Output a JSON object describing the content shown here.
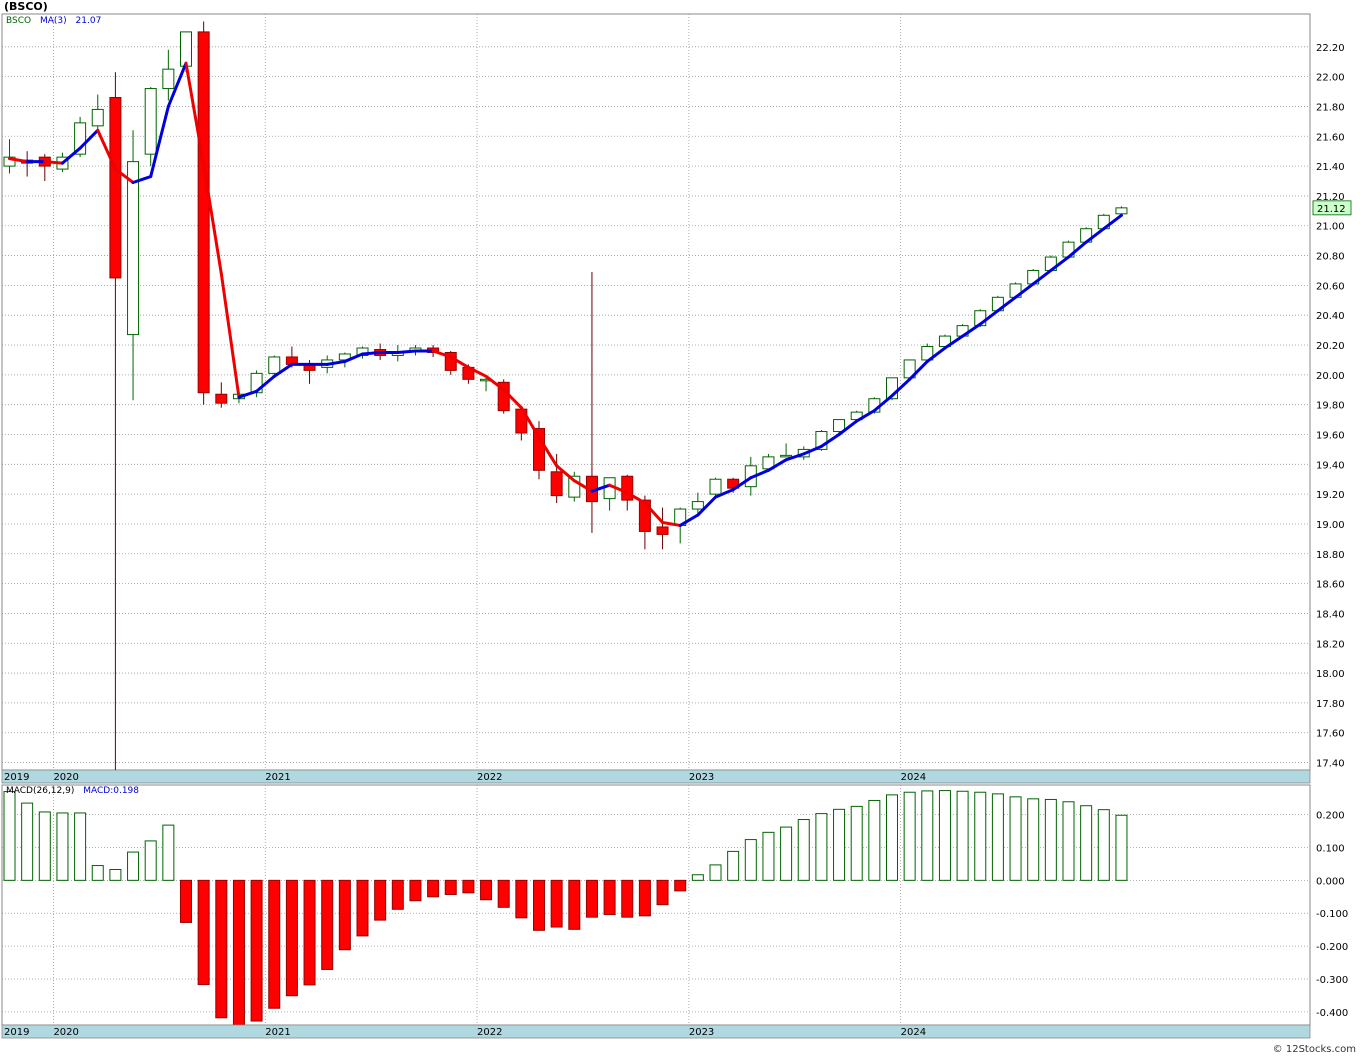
{
  "header": {
    "title": "(BSCO)"
  },
  "price_legend": {
    "symbol": "BSCO",
    "ma_label": "MA(3)",
    "ma_value": "21.07"
  },
  "macd_legend": {
    "label": "MACD(26,12,9)",
    "value_label": "MACD:0.198"
  },
  "last_price_label": "21.12",
  "credit": "© 12Stocks.com",
  "colors": {
    "up": "#006400",
    "down": "#ff0000",
    "ma_up": "#0000dd",
    "ma_down": "#ee0000",
    "axis_band": "#b0d8e0",
    "grid": "#999999"
  },
  "chart_data": [
    {
      "type": "candlestick",
      "title": "(BSCO)",
      "ylim": [
        17.35,
        22.42
      ],
      "yticks": [
        "17.40",
        "17.60",
        "17.80",
        "18.00",
        "18.20",
        "18.40",
        "18.60",
        "18.80",
        "19.00",
        "19.20",
        "19.40",
        "19.60",
        "19.80",
        "20.00",
        "20.20",
        "20.40",
        "20.60",
        "20.80",
        "21.00",
        "21.20",
        "21.40",
        "21.60",
        "21.80",
        "22.00",
        "22.20"
      ],
      "x_labels": [
        "2019",
        "2020",
        "2021",
        "2022",
        "2023",
        "2024"
      ],
      "months_per_year_start_index": {
        "2020": 3,
        "2021": 15,
        "2022": 27,
        "2023": 39,
        "2024": 51
      },
      "candles": [
        {
          "o": 21.4,
          "h": 21.58,
          "l": 21.35,
          "c": 21.46
        },
        {
          "o": 21.44,
          "h": 21.5,
          "l": 21.33,
          "c": 21.42
        },
        {
          "o": 21.46,
          "h": 21.48,
          "l": 21.3,
          "c": 21.4
        },
        {
          "o": 21.38,
          "h": 21.49,
          "l": 21.36,
          "c": 21.46
        },
        {
          "o": 21.48,
          "h": 21.73,
          "l": 21.46,
          "c": 21.69
        },
        {
          "o": 21.67,
          "h": 21.88,
          "l": 21.64,
          "c": 21.78
        },
        {
          "o": 21.86,
          "h": 22.03,
          "l": 17.35,
          "c": 20.65
        },
        {
          "o": 20.27,
          "h": 21.64,
          "l": 19.83,
          "c": 21.43
        },
        {
          "o": 21.48,
          "h": 21.93,
          "l": 21.4,
          "c": 21.92
        },
        {
          "o": 21.92,
          "h": 22.18,
          "l": 21.84,
          "c": 22.05
        },
        {
          "o": 22.07,
          "h": 22.3,
          "l": 22.03,
          "c": 22.3
        },
        {
          "o": 22.3,
          "h": 22.37,
          "l": 19.8,
          "c": 19.88
        },
        {
          "o": 19.87,
          "h": 19.95,
          "l": 19.78,
          "c": 19.81
        },
        {
          "o": 19.84,
          "h": 19.9,
          "l": 19.81,
          "c": 19.87
        },
        {
          "o": 19.88,
          "h": 20.03,
          "l": 19.85,
          "c": 20.01
        },
        {
          "o": 20.01,
          "h": 20.13,
          "l": 19.99,
          "c": 20.12
        },
        {
          "o": 20.12,
          "h": 20.19,
          "l": 20.05,
          "c": 20.07
        },
        {
          "o": 20.07,
          "h": 20.1,
          "l": 19.94,
          "c": 20.03
        },
        {
          "o": 20.05,
          "h": 20.13,
          "l": 20.01,
          "c": 20.1
        },
        {
          "o": 20.1,
          "h": 20.15,
          "l": 20.05,
          "c": 20.14
        },
        {
          "o": 20.13,
          "h": 20.19,
          "l": 20.11,
          "c": 20.18
        },
        {
          "o": 20.17,
          "h": 20.21,
          "l": 20.1,
          "c": 20.13
        },
        {
          "o": 20.13,
          "h": 20.2,
          "l": 20.09,
          "c": 20.15
        },
        {
          "o": 20.16,
          "h": 20.2,
          "l": 20.13,
          "c": 20.18
        },
        {
          "o": 20.18,
          "h": 20.2,
          "l": 20.12,
          "c": 20.15
        },
        {
          "o": 20.15,
          "h": 20.16,
          "l": 20.0,
          "c": 20.03
        },
        {
          "o": 20.05,
          "h": 20.07,
          "l": 19.94,
          "c": 19.97
        },
        {
          "o": 19.96,
          "h": 19.99,
          "l": 19.89,
          "c": 19.97
        },
        {
          "o": 19.95,
          "h": 19.97,
          "l": 19.74,
          "c": 19.76
        },
        {
          "o": 19.77,
          "h": 19.78,
          "l": 19.56,
          "c": 19.61
        },
        {
          "o": 19.64,
          "h": 19.69,
          "l": 19.3,
          "c": 19.36
        },
        {
          "o": 19.35,
          "h": 19.47,
          "l": 19.14,
          "c": 19.19
        },
        {
          "o": 19.18,
          "h": 19.35,
          "l": 19.15,
          "c": 19.32
        },
        {
          "o": 19.32,
          "h": 20.69,
          "l": 18.94,
          "c": 19.15
        },
        {
          "o": 19.17,
          "h": 19.31,
          "l": 19.09,
          "c": 19.31
        },
        {
          "o": 19.32,
          "h": 19.33,
          "l": 19.09,
          "c": 19.16
        },
        {
          "o": 19.16,
          "h": 19.19,
          "l": 18.83,
          "c": 18.95
        },
        {
          "o": 18.98,
          "h": 19.11,
          "l": 18.83,
          "c": 18.93
        },
        {
          "o": 18.99,
          "h": 19.11,
          "l": 18.87,
          "c": 19.1
        },
        {
          "o": 19.1,
          "h": 19.21,
          "l": 19.06,
          "c": 19.15
        },
        {
          "o": 19.2,
          "h": 19.31,
          "l": 19.19,
          "c": 19.3
        },
        {
          "o": 19.3,
          "h": 19.31,
          "l": 19.21,
          "c": 19.24
        },
        {
          "o": 19.25,
          "h": 19.45,
          "l": 19.19,
          "c": 19.39
        },
        {
          "o": 19.37,
          "h": 19.47,
          "l": 19.36,
          "c": 19.45
        },
        {
          "o": 19.45,
          "h": 19.54,
          "l": 19.45,
          "c": 19.46
        },
        {
          "o": 19.45,
          "h": 19.52,
          "l": 19.43,
          "c": 19.5
        },
        {
          "o": 19.5,
          "h": 19.63,
          "l": 19.49,
          "c": 19.62
        },
        {
          "o": 19.62,
          "h": 19.7,
          "l": 19.61,
          "c": 19.7
        },
        {
          "o": 19.7,
          "h": 19.76,
          "l": 19.69,
          "c": 19.75
        },
        {
          "o": 19.75,
          "h": 19.85,
          "l": 19.74,
          "c": 19.84
        },
        {
          "o": 19.84,
          "h": 19.98,
          "l": 19.83,
          "c": 19.98
        },
        {
          "o": 19.98,
          "h": 20.1,
          "l": 19.97,
          "c": 20.1
        },
        {
          "o": 20.1,
          "h": 20.21,
          "l": 20.09,
          "c": 20.19
        },
        {
          "o": 20.19,
          "h": 20.27,
          "l": 20.18,
          "c": 20.26
        },
        {
          "o": 20.26,
          "h": 20.34,
          "l": 20.25,
          "c": 20.33
        },
        {
          "o": 20.33,
          "h": 20.44,
          "l": 20.32,
          "c": 20.43
        },
        {
          "o": 20.43,
          "h": 20.53,
          "l": 20.42,
          "c": 20.52
        },
        {
          "o": 20.52,
          "h": 20.62,
          "l": 20.51,
          "c": 20.61
        },
        {
          "o": 20.61,
          "h": 20.71,
          "l": 20.6,
          "c": 20.7
        },
        {
          "o": 20.7,
          "h": 20.8,
          "l": 20.69,
          "c": 20.79
        },
        {
          "o": 20.79,
          "h": 20.9,
          "l": 20.78,
          "c": 20.89
        },
        {
          "o": 20.89,
          "h": 20.99,
          "l": 20.88,
          "c": 20.98
        },
        {
          "o": 20.98,
          "h": 21.08,
          "l": 20.97,
          "c": 21.07
        },
        {
          "o": 21.08,
          "h": 21.13,
          "l": 21.08,
          "c": 21.12
        }
      ],
      "ma": {
        "name": "MA(3)",
        "values": [
          21.45,
          21.43,
          21.43,
          21.42,
          21.52,
          21.64,
          21.38,
          21.29,
          21.33,
          21.8,
          22.09,
          21.41,
          20.68,
          19.85,
          19.89,
          19.99,
          20.07,
          20.07,
          20.07,
          20.09,
          20.14,
          20.15,
          20.15,
          20.16,
          20.16,
          20.12,
          20.05,
          19.99,
          19.9,
          19.78,
          19.58,
          19.39,
          19.29,
          19.22,
          19.26,
          19.21,
          19.14,
          19.01,
          18.99,
          19.06,
          19.18,
          19.23,
          19.31,
          19.36,
          19.43,
          19.47,
          19.52,
          19.6,
          19.69,
          19.76,
          19.86,
          19.97,
          20.09,
          20.18,
          20.26,
          20.34,
          20.43,
          20.52,
          20.61,
          20.7,
          20.79,
          20.89,
          20.98,
          21.07
        ]
      }
    },
    {
      "type": "bar",
      "title": "MACD(26,12,9)",
      "ylim": [
        -0.44,
        0.29
      ],
      "yticks": [
        "-0.400",
        "-0.300",
        "-0.200",
        "-0.100",
        "0.000",
        "0.100",
        "0.200"
      ],
      "x_labels": [
        "2019",
        "2020",
        "2021",
        "2022",
        "2023",
        "2024"
      ],
      "values": [
        0.27,
        0.235,
        0.208,
        0.205,
        0.205,
        0.045,
        0.033,
        0.086,
        0.12,
        0.168,
        -0.128,
        -0.317,
        -0.418,
        -0.44,
        -0.428,
        -0.389,
        -0.351,
        -0.318,
        -0.271,
        -0.211,
        -0.169,
        -0.121,
        -0.088,
        -0.062,
        -0.05,
        -0.043,
        -0.038,
        -0.059,
        -0.082,
        -0.114,
        -0.152,
        -0.142,
        -0.149,
        -0.112,
        -0.104,
        -0.112,
        -0.108,
        -0.074,
        -0.032,
        0.017,
        0.047,
        0.088,
        0.124,
        0.146,
        0.162,
        0.185,
        0.203,
        0.216,
        0.225,
        0.243,
        0.26,
        0.268,
        0.272,
        0.273,
        0.271,
        0.268,
        0.263,
        0.254,
        0.248,
        0.246,
        0.239,
        0.227,
        0.215,
        0.198
      ]
    }
  ]
}
